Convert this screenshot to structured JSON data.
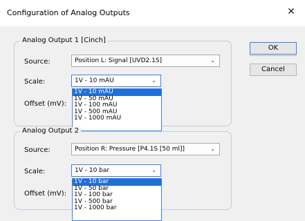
{
  "window": {
    "title": "Configuration of Analog Outputs",
    "close_glyph": "✕"
  },
  "buttons": {
    "ok": "OK",
    "cancel": "Cancel"
  },
  "output1": {
    "legend": "Analog Output 1 [Cinch]",
    "source_label": "Source:",
    "source_value": "Position L: Signal [UVD2.1S]",
    "scale_label": "Scale:",
    "scale_value": "1V - 10 mAU",
    "offset_label": "Offset (mV):",
    "scale_options": [
      "1V - 10 mAU",
      "1V - 50 mAU",
      "1V - 100 mAU",
      "1V - 500 mAU",
      "1V - 1000 mAU"
    ]
  },
  "output2": {
    "legend": "Analog Output 2",
    "source_label": "Source:",
    "source_value": "Position R: Pressure [P4.1S [50 ml]]",
    "scale_label": "Scale:",
    "scale_value": "1V - 10 bar",
    "offset_label": "Offset (mV):",
    "scale_options": [
      "1V - 10 bar",
      "1V - 50 bar",
      "1V - 100 bar",
      "1V - 500 bar",
      "1V - 1000 bar"
    ]
  },
  "icons": {
    "chevron": "chevron-down-icon",
    "close": "close-icon"
  }
}
